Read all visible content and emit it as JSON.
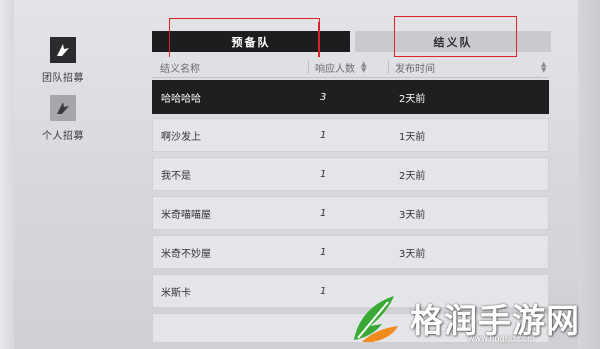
{
  "sidebar": {
    "items": [
      {
        "label": "团队招募",
        "icon": "team-recruit-icon",
        "active": true
      },
      {
        "label": "个人招募",
        "icon": "personal-recruit-icon",
        "active": false
      }
    ]
  },
  "tabs": [
    {
      "label": "预备队",
      "active": true
    },
    {
      "label": "结义队",
      "active": false
    }
  ],
  "table": {
    "headers": [
      "结义名称",
      "响应人数",
      "发布时间"
    ],
    "rows": [
      {
        "name": "哈哈哈哈",
        "count": "3",
        "time": "2天前",
        "selected": true
      },
      {
        "name": "啊沙发上",
        "count": "1",
        "time": "1天前",
        "selected": false
      },
      {
        "name": "我不是",
        "count": "1",
        "time": "2天前",
        "selected": false
      },
      {
        "name": "米奇喵喵屋",
        "count": "1",
        "time": "3天前",
        "selected": false
      },
      {
        "name": "米奇不妙屋",
        "count": "1",
        "time": "3天前",
        "selected": false
      },
      {
        "name": "米斯卡",
        "count": "1",
        "time": "",
        "selected": false
      }
    ]
  },
  "watermark": {
    "text": "格润手游网",
    "url": "www.hngrjd.com",
    "colors": {
      "green": "#3aa935",
      "orange": "#f08a1c"
    }
  },
  "colors": {
    "highlight_red": "#d9252a",
    "dark": "#1d1d1f"
  }
}
